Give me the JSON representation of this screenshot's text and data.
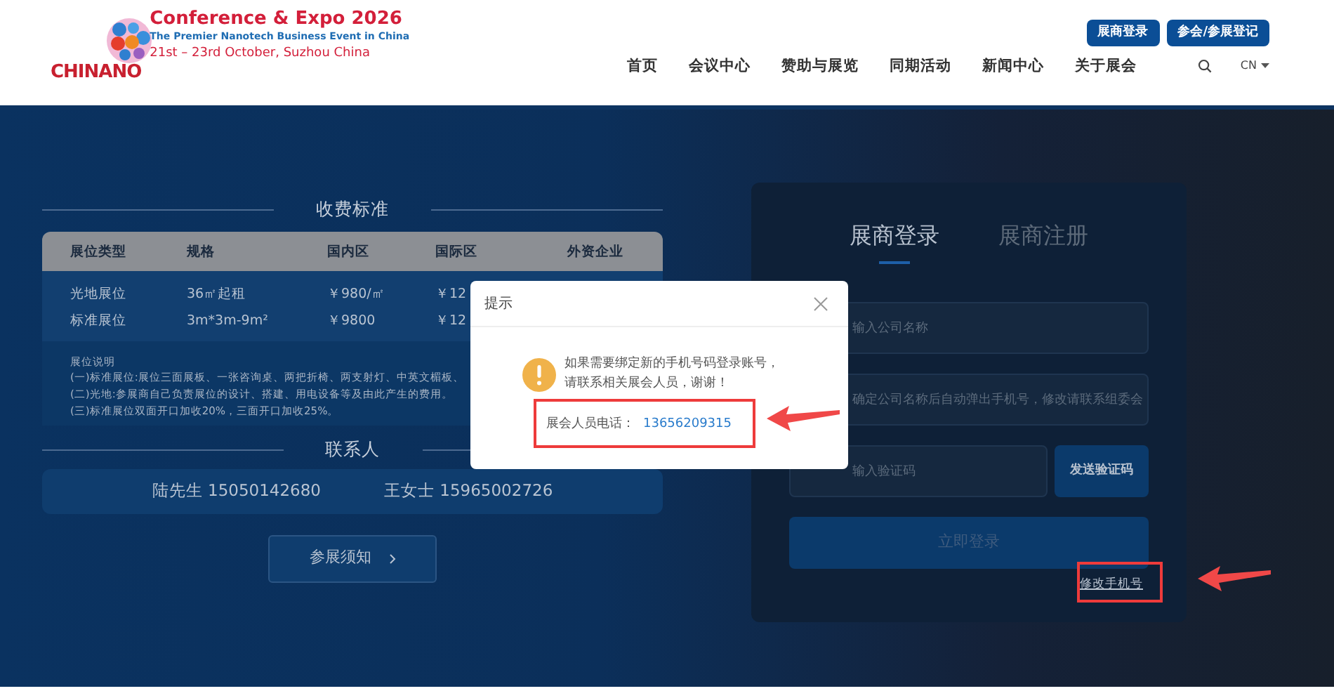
{
  "header": {
    "logo": {
      "wordmark": "CHINANO",
      "title": "Conference & Expo 2026",
      "subtitle": "The Premier Nanotech Business Event in China",
      "dates": "21st – 23rd  October, Suzhou China"
    },
    "top_buttons": [
      "展商登录",
      "参会/参展登记"
    ],
    "nav": [
      {
        "label": "首页"
      },
      {
        "label": "会议中心"
      },
      {
        "label": "赞助与展览"
      },
      {
        "label": "同期活动"
      },
      {
        "label": "新闻中心"
      },
      {
        "label": "关于展会"
      }
    ],
    "language": "CN"
  },
  "fees": {
    "title": "收费标准",
    "columns": [
      "展位类型",
      "规格",
      "国内区",
      "国际区",
      "外资企业"
    ],
    "rows": [
      [
        "光地展位",
        "36㎡起租",
        "￥980/㎡",
        "￥12"
      ],
      [
        "标准展位",
        "3m*3m-9m²",
        "￥9800",
        "￥12"
      ]
    ],
    "notes_title": "展位说明",
    "notes": [
      "(一)标准展位:展位三面展板、一张咨询桌、两把折椅、两支射灯、中英文楣板、",
      "(二)光地:参展商自己负责展位的设计、搭建、用电设备等及由此产生的费用。",
      "(三)标准展位双面开口加收20%，三面开口加收25%。"
    ]
  },
  "contacts": {
    "title": "联系人",
    "people": [
      "陆先生 15050142680",
      "王女士 15965002726"
    ]
  },
  "notice_button": "参展须知",
  "login": {
    "tabs": [
      {
        "label": "展商登录",
        "selected": true
      },
      {
        "label": "展商注册",
        "selected": false
      }
    ],
    "fields": [
      {
        "placeholder": "输入公司名称"
      },
      {
        "placeholder": "确定公司名称后自动弹出手机号，修改请联系组委会"
      },
      {
        "placeholder": "输入验证码"
      }
    ],
    "send_code": "发送验证码",
    "submit": "立即登录",
    "change_phone": "修改手机号"
  },
  "dialog": {
    "title": "提示",
    "message": [
      "如果需要绑定新的手机号码登录账号，",
      "请联系相关展会人员，谢谢！"
    ],
    "phone_label": "展会人员电话：",
    "phone": "13656209315"
  }
}
